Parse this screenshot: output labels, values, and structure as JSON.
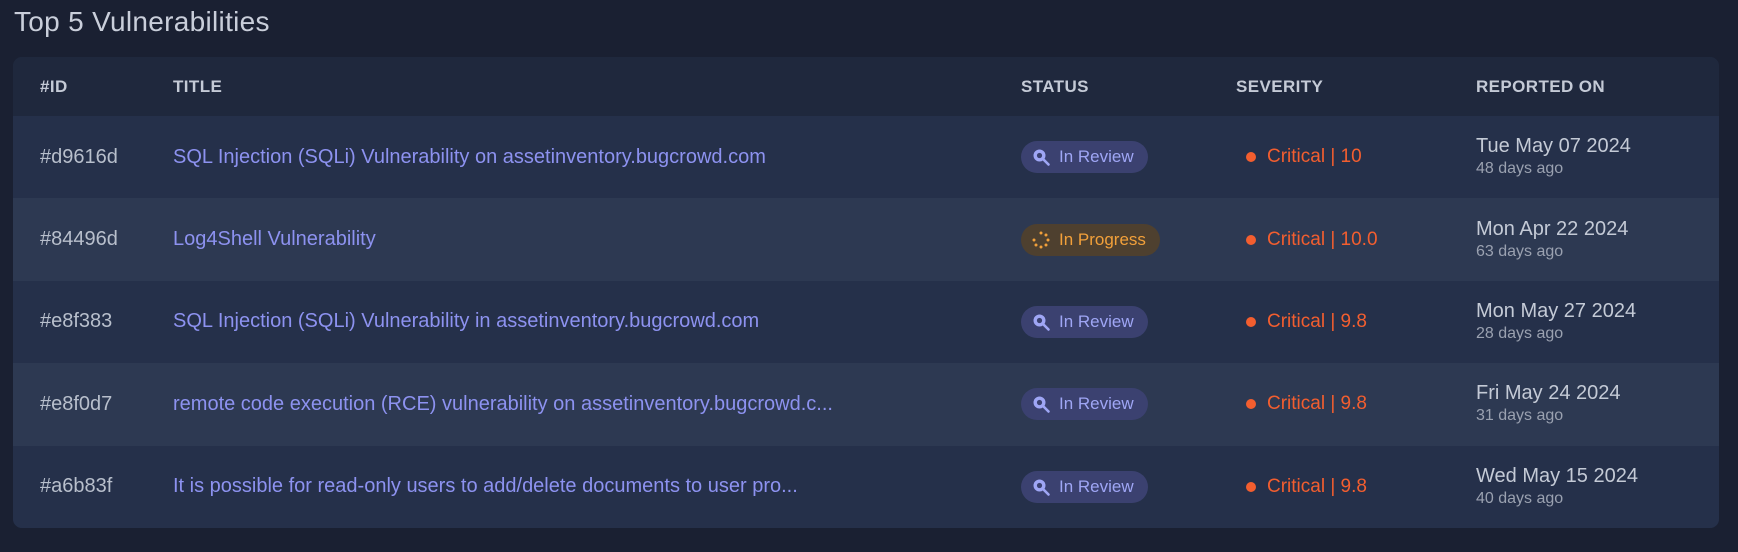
{
  "page": {
    "title": "Top 5 Vulnerabilities"
  },
  "table": {
    "columns": {
      "id": "#ID",
      "title": "TITLE",
      "status": "STATUS",
      "severity": "SEVERITY",
      "reported": "REPORTED ON"
    },
    "rows": [
      {
        "id": "#d9616d",
        "title": "SQL Injection (SQLi) Vulnerability on assetinventory.bugcrowd.com",
        "status": "In Review",
        "status_icon": "magnifier-icon",
        "severity": "Critical | 10",
        "date": "Tue May 07 2024",
        "ago": "48 days ago"
      },
      {
        "id": "#84496d",
        "title": "Log4Shell Vulnerability",
        "status": "In Progress",
        "status_icon": "spinner-icon",
        "severity": "Critical | 10.0",
        "date": "Mon Apr 22 2024",
        "ago": "63 days ago"
      },
      {
        "id": "#e8f383",
        "title": "SQL Injection (SQLi) Vulnerability in assetinventory.bugcrowd.com",
        "status": "In Review",
        "status_icon": "magnifier-icon",
        "severity": "Critical | 9.8",
        "date": "Mon May 27 2024",
        "ago": "28 days ago"
      },
      {
        "id": "#e8f0d7",
        "title": "remote code execution (RCE) vulnerability on assetinventory.bugcrowd.c...",
        "status": "In Review",
        "status_icon": "magnifier-icon",
        "severity": "Critical | 9.8",
        "date": "Fri May 24 2024",
        "ago": "31 days ago"
      },
      {
        "id": "#a6b83f",
        "title": "It is possible for read-only users to add/delete documents to user pro...",
        "status": "In Review",
        "status_icon": "magnifier-icon",
        "severity": "Critical | 9.8",
        "date": "Wed May 15 2024",
        "ago": "40 days ago"
      }
    ]
  },
  "colors": {
    "background": "#1a2032",
    "panel": "#222c44",
    "link": "#8d92f0",
    "critical": "#f35e2f",
    "in_review": "#9fa6f5",
    "in_progress": "#f2a03a"
  }
}
